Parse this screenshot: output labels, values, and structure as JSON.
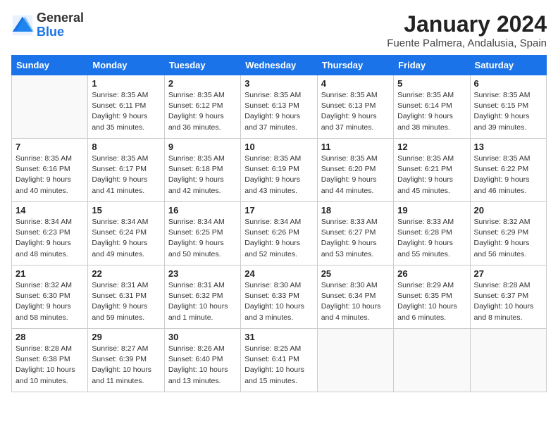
{
  "header": {
    "logo_general": "General",
    "logo_blue": "Blue",
    "title": "January 2024",
    "subtitle": "Fuente Palmera, Andalusia, Spain"
  },
  "calendar": {
    "columns": [
      "Sunday",
      "Monday",
      "Tuesday",
      "Wednesday",
      "Thursday",
      "Friday",
      "Saturday"
    ],
    "weeks": [
      [
        {
          "day": "",
          "info": ""
        },
        {
          "day": "1",
          "info": "Sunrise: 8:35 AM\nSunset: 6:11 PM\nDaylight: 9 hours\nand 35 minutes."
        },
        {
          "day": "2",
          "info": "Sunrise: 8:35 AM\nSunset: 6:12 PM\nDaylight: 9 hours\nand 36 minutes."
        },
        {
          "day": "3",
          "info": "Sunrise: 8:35 AM\nSunset: 6:13 PM\nDaylight: 9 hours\nand 37 minutes."
        },
        {
          "day": "4",
          "info": "Sunrise: 8:35 AM\nSunset: 6:13 PM\nDaylight: 9 hours\nand 37 minutes."
        },
        {
          "day": "5",
          "info": "Sunrise: 8:35 AM\nSunset: 6:14 PM\nDaylight: 9 hours\nand 38 minutes."
        },
        {
          "day": "6",
          "info": "Sunrise: 8:35 AM\nSunset: 6:15 PM\nDaylight: 9 hours\nand 39 minutes."
        }
      ],
      [
        {
          "day": "7",
          "info": "Sunrise: 8:35 AM\nSunset: 6:16 PM\nDaylight: 9 hours\nand 40 minutes."
        },
        {
          "day": "8",
          "info": "Sunrise: 8:35 AM\nSunset: 6:17 PM\nDaylight: 9 hours\nand 41 minutes."
        },
        {
          "day": "9",
          "info": "Sunrise: 8:35 AM\nSunset: 6:18 PM\nDaylight: 9 hours\nand 42 minutes."
        },
        {
          "day": "10",
          "info": "Sunrise: 8:35 AM\nSunset: 6:19 PM\nDaylight: 9 hours\nand 43 minutes."
        },
        {
          "day": "11",
          "info": "Sunrise: 8:35 AM\nSunset: 6:20 PM\nDaylight: 9 hours\nand 44 minutes."
        },
        {
          "day": "12",
          "info": "Sunrise: 8:35 AM\nSunset: 6:21 PM\nDaylight: 9 hours\nand 45 minutes."
        },
        {
          "day": "13",
          "info": "Sunrise: 8:35 AM\nSunset: 6:22 PM\nDaylight: 9 hours\nand 46 minutes."
        }
      ],
      [
        {
          "day": "14",
          "info": "Sunrise: 8:34 AM\nSunset: 6:23 PM\nDaylight: 9 hours\nand 48 minutes."
        },
        {
          "day": "15",
          "info": "Sunrise: 8:34 AM\nSunset: 6:24 PM\nDaylight: 9 hours\nand 49 minutes."
        },
        {
          "day": "16",
          "info": "Sunrise: 8:34 AM\nSunset: 6:25 PM\nDaylight: 9 hours\nand 50 minutes."
        },
        {
          "day": "17",
          "info": "Sunrise: 8:34 AM\nSunset: 6:26 PM\nDaylight: 9 hours\nand 52 minutes."
        },
        {
          "day": "18",
          "info": "Sunrise: 8:33 AM\nSunset: 6:27 PM\nDaylight: 9 hours\nand 53 minutes."
        },
        {
          "day": "19",
          "info": "Sunrise: 8:33 AM\nSunset: 6:28 PM\nDaylight: 9 hours\nand 55 minutes."
        },
        {
          "day": "20",
          "info": "Sunrise: 8:32 AM\nSunset: 6:29 PM\nDaylight: 9 hours\nand 56 minutes."
        }
      ],
      [
        {
          "day": "21",
          "info": "Sunrise: 8:32 AM\nSunset: 6:30 PM\nDaylight: 9 hours\nand 58 minutes."
        },
        {
          "day": "22",
          "info": "Sunrise: 8:31 AM\nSunset: 6:31 PM\nDaylight: 9 hours\nand 59 minutes."
        },
        {
          "day": "23",
          "info": "Sunrise: 8:31 AM\nSunset: 6:32 PM\nDaylight: 10 hours\nand 1 minute."
        },
        {
          "day": "24",
          "info": "Sunrise: 8:30 AM\nSunset: 6:33 PM\nDaylight: 10 hours\nand 3 minutes."
        },
        {
          "day": "25",
          "info": "Sunrise: 8:30 AM\nSunset: 6:34 PM\nDaylight: 10 hours\nand 4 minutes."
        },
        {
          "day": "26",
          "info": "Sunrise: 8:29 AM\nSunset: 6:35 PM\nDaylight: 10 hours\nand 6 minutes."
        },
        {
          "day": "27",
          "info": "Sunrise: 8:28 AM\nSunset: 6:37 PM\nDaylight: 10 hours\nand 8 minutes."
        }
      ],
      [
        {
          "day": "28",
          "info": "Sunrise: 8:28 AM\nSunset: 6:38 PM\nDaylight: 10 hours\nand 10 minutes."
        },
        {
          "day": "29",
          "info": "Sunrise: 8:27 AM\nSunset: 6:39 PM\nDaylight: 10 hours\nand 11 minutes."
        },
        {
          "day": "30",
          "info": "Sunrise: 8:26 AM\nSunset: 6:40 PM\nDaylight: 10 hours\nand 13 minutes."
        },
        {
          "day": "31",
          "info": "Sunrise: 8:25 AM\nSunset: 6:41 PM\nDaylight: 10 hours\nand 15 minutes."
        },
        {
          "day": "",
          "info": ""
        },
        {
          "day": "",
          "info": ""
        },
        {
          "day": "",
          "info": ""
        }
      ]
    ]
  }
}
